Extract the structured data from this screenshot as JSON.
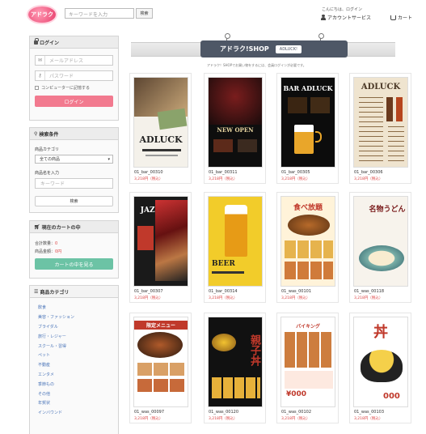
{
  "header": {
    "logo_text": "アドラク",
    "search_placeholder": "キーワードを入力",
    "search_button": "検索",
    "greeting": "こんにちは、ログイン",
    "account_label": "アカウントサービス",
    "cart_label": "カート"
  },
  "login": {
    "title": "ログイン",
    "email_placeholder": "メールアドレス",
    "password_placeholder": "パスワード",
    "remember_label": "コンピューターに記憶する",
    "submit_label": "ログイン"
  },
  "search_panel": {
    "title": "検索条件",
    "category_label": "商品カテゴリ",
    "category_value": "全ての商品",
    "keyword_label": "商品名を入力",
    "keyword_placeholder": "キーワード",
    "submit_label": "検索"
  },
  "cart_panel": {
    "title": "現在のカートの中",
    "count_label": "合計数量：",
    "count_value": "0",
    "total_label": "商品金額：",
    "total_value": "0円",
    "view_label": "カートの中を見る"
  },
  "categories": {
    "title": "商品カテゴリ",
    "items": [
      "飲食",
      "美容・ファッション",
      "ブライダル",
      "旅行・レジャー",
      "スクール・習得",
      "ペット",
      "不動産",
      "エンタメ",
      "季節もの",
      "その他",
      "年賀状",
      "インバウンド"
    ]
  },
  "banner": {
    "title": "アドラク!SHOP",
    "badge": "ADLUCK!",
    "notice": "アドラク！SHOPでお買い物をするには、会員ログインが必要です。"
  },
  "products": [
    {
      "code": "01_bar_00310",
      "price": "3,218円（税込）",
      "thumb_text": "ADLUCK"
    },
    {
      "code": "01_bar_00311",
      "price": "3,218円（税込）",
      "thumb_text": "NEW OPEN"
    },
    {
      "code": "01_bar_00305",
      "price": "3,218円（税込）",
      "thumb_text": "BAR ADLUCK"
    },
    {
      "code": "01_bar_00306",
      "price": "3,218円（税込）",
      "thumb_text": "ADLUCK"
    },
    {
      "code": "01_bar_00307",
      "price": "3,218円（税込）",
      "thumb_text": "JAZZ"
    },
    {
      "code": "01_bar_00314",
      "price": "3,218円（税込）",
      "thumb_text": "BEER"
    },
    {
      "code": "01_was_00101",
      "price": "3,218円（税込）",
      "thumb_text": "食べ放題"
    },
    {
      "code": "01_was_00118",
      "price": "3,218円（税込）",
      "thumb_text": "名物うどん"
    },
    {
      "code": "01_was_00097",
      "price": "3,218円（税込）",
      "thumb_text": "限定メニュー"
    },
    {
      "code": "01_was_00120",
      "price": "3,218円（税込）",
      "thumb_text": "親子丼"
    },
    {
      "code": "01_was_00102",
      "price": "3,218円（税込）",
      "thumb_text": "バイキング"
    },
    {
      "code": "01_was_00103",
      "price": "3,218円（税込）",
      "thumb_text": "丼"
    }
  ],
  "colors": {
    "login_button": "#f27a8f",
    "cart_button": "#6cc3a5",
    "price": "#dd4444",
    "banner": "#4e5766",
    "category_link": "#4a74b8"
  }
}
